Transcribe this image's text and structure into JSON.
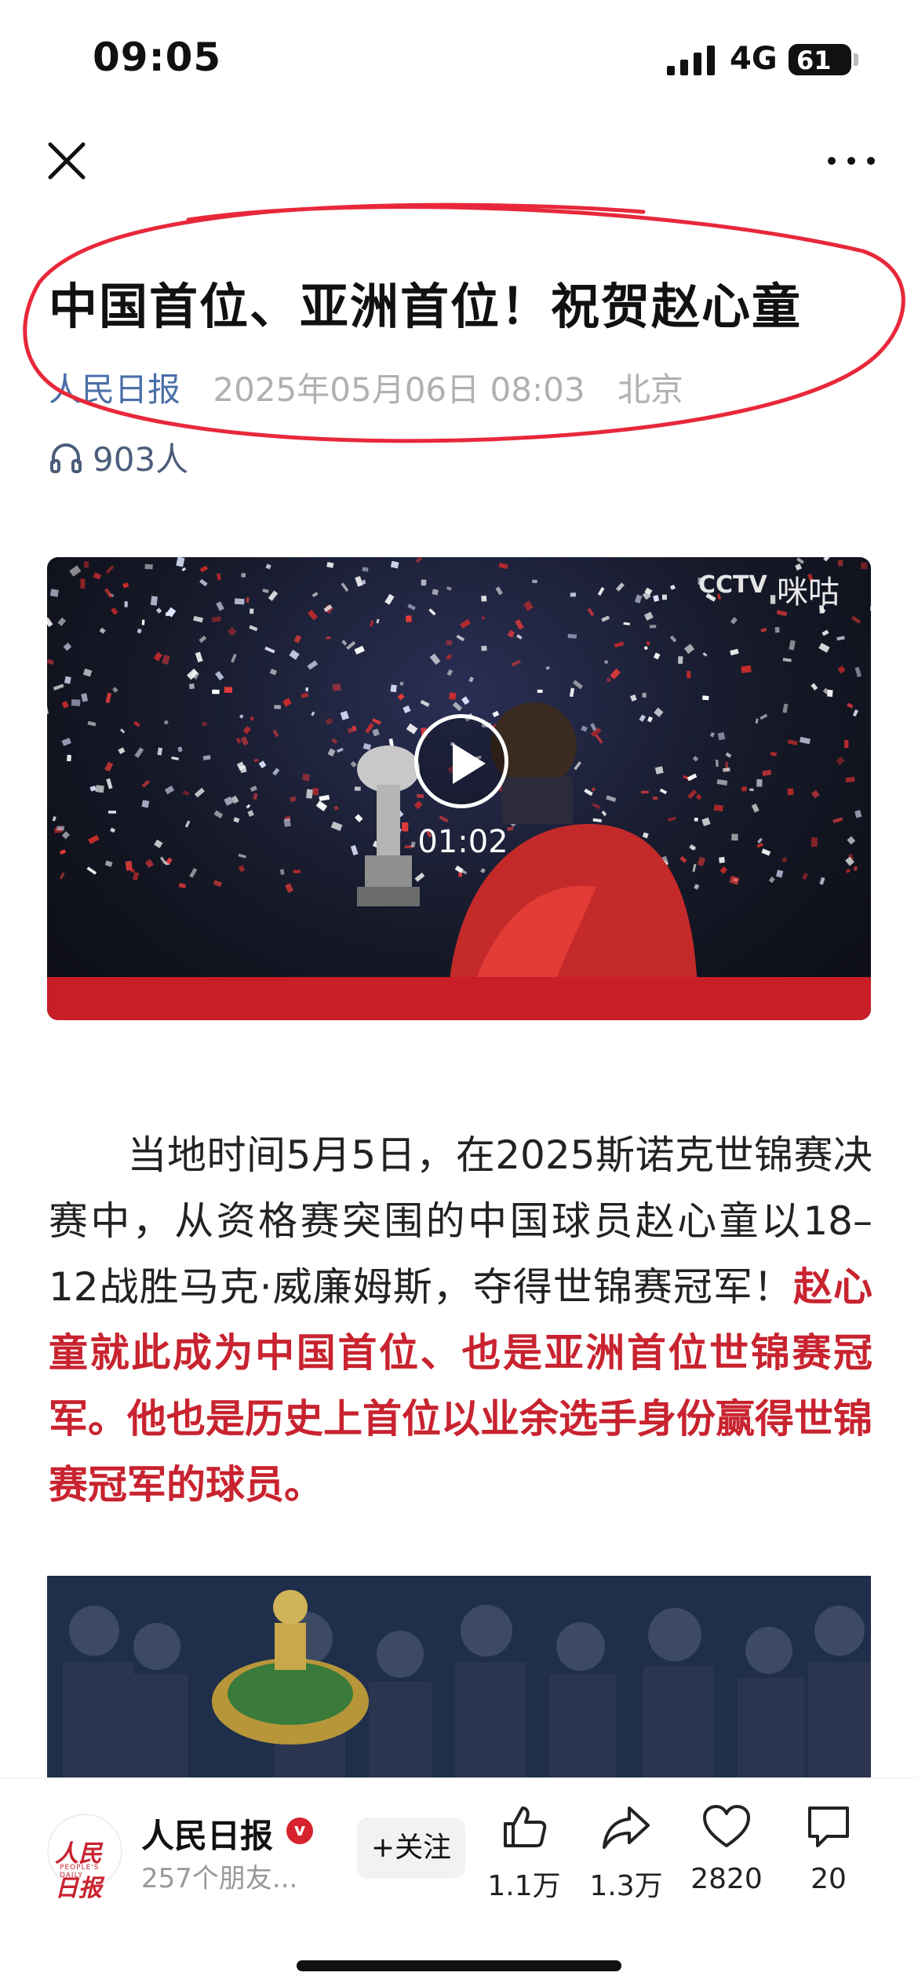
{
  "status_bar": {
    "time": "09:05",
    "network": "4G",
    "battery": "61",
    "battery_fraction": 0.61
  },
  "article": {
    "title": "中国首位、亚洲首位！祝贺赵心童",
    "source": "人民日报",
    "date": "2025年05月06日 08:03",
    "location": "北京",
    "listeners": "903人"
  },
  "video": {
    "duration": "01:02",
    "watermark_left": "CCTV",
    "watermark_right": "咪咕"
  },
  "body": {
    "text_plain": "当地时间5月5日，在2025斯诺克世锦赛决赛中，从资格赛突围的中国球员赵心童以18–12战胜马克·威廉姆斯，夺得世锦赛冠军！",
    "text_highlight": "赵心童就此成为中国首位、也是亚洲首位世锦赛冠军。他也是历史上首位以业余选手身份赢得世锦赛冠军的球员。"
  },
  "bottom_bar": {
    "account_name": "人民日报",
    "avatar_text": "人民日报",
    "avatar_sub": "PEOPLE'S DAILY",
    "verified_mark": "v",
    "friends": "257个朋友...",
    "follow_label": "+关注",
    "like_count": "1.1万",
    "share_count": "1.3万",
    "favorite_count": "2820",
    "comment_count": "20"
  },
  "colors": {
    "highlight_red": "#c8232f",
    "source_blue": "#4b6fa8",
    "annotation_red": "#e8283a"
  }
}
